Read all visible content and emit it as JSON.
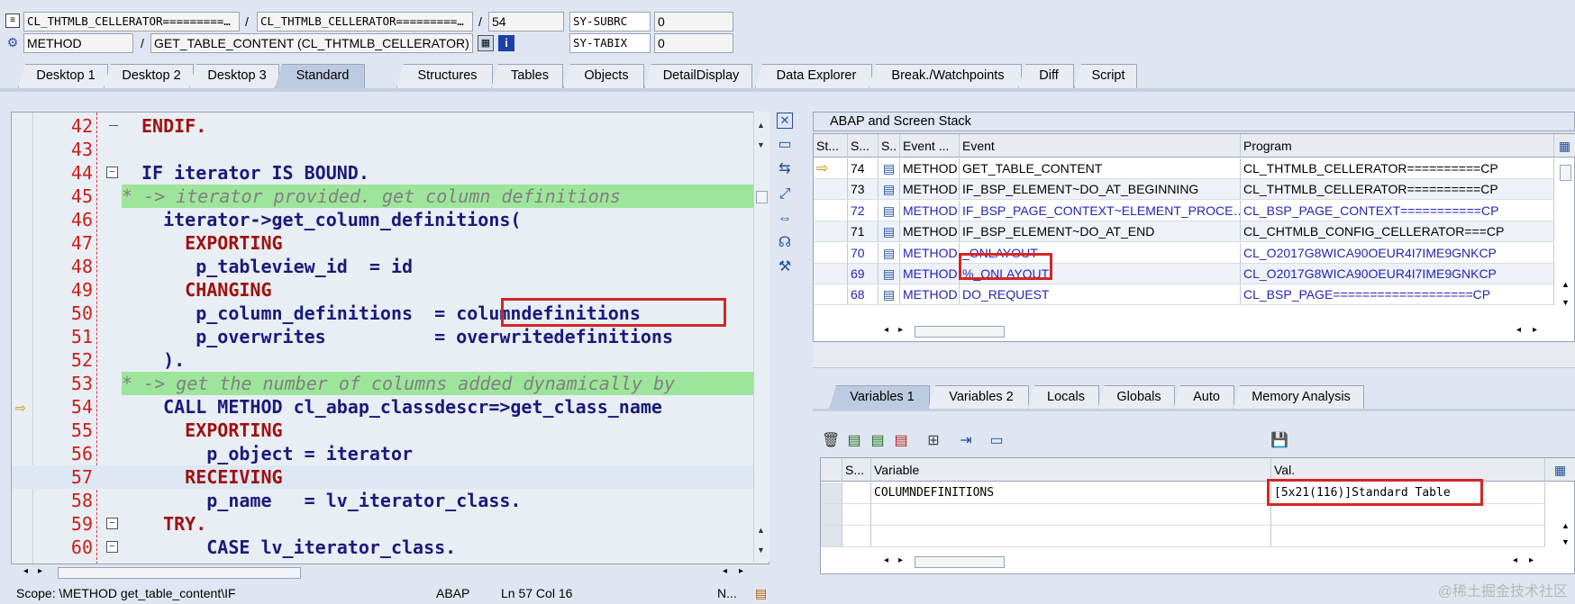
{
  "header": {
    "row1": {
      "class_field": "CL_THTMLB_CELLERATOR=========…",
      "program_field": "CL_THTMLB_CELLERATOR=========…",
      "line_field": "54",
      "sysvar1_name": "SY-SUBRC",
      "sysvar1_value": "0",
      "sep1": "/",
      "sep2": "/"
    },
    "row2": {
      "type_field": "METHOD",
      "method_field": "GET_TABLE_CONTENT (CL_THTMLB_CELLERATOR)",
      "sysvar2_name": "SY-TABIX",
      "sysvar2_value": "0",
      "sep": "/"
    }
  },
  "tabs": [
    "Desktop 1",
    "Desktop 2",
    "Desktop 3",
    "Standard",
    "Structures",
    "Tables",
    "Objects",
    "DetailDisplay",
    "Data Explorer",
    "Break./Watchpoints",
    "Diff",
    "Script"
  ],
  "active_tab": "Standard",
  "editor": {
    "lines": [
      {
        "n": "42",
        "text": "ENDIF.",
        "kind": "kw"
      },
      {
        "n": "43",
        "text": "",
        "kind": "plain"
      },
      {
        "n": "44",
        "text": "IF iterator IS BOUND.",
        "kind": "if"
      },
      {
        "n": "45",
        "text": "* -> iterator provided. get column definitions",
        "kind": "comment"
      },
      {
        "n": "46",
        "text": "  iterator->get_column_definitions(",
        "kind": "call"
      },
      {
        "n": "47",
        "text": "    EXPORTING",
        "kind": "kw"
      },
      {
        "n": "48",
        "text": "     p_tableview_id  = id",
        "kind": "assign"
      },
      {
        "n": "49",
        "text": "    CHANGING",
        "kind": "kw"
      },
      {
        "n": "50",
        "text": "     p_column_definitions  = columndefinitions",
        "kind": "assign"
      },
      {
        "n": "51",
        "text": "     p_overwrites          = overwritedefinitions",
        "kind": "assign"
      },
      {
        "n": "52",
        "text": "  ).",
        "kind": "op"
      },
      {
        "n": "53",
        "text": "* -> get the number of columns added dynamically by",
        "kind": "comment"
      },
      {
        "n": "54",
        "text": "  CALL METHOD cl_abap_classdescr=>get_class_name",
        "kind": "callm"
      },
      {
        "n": "55",
        "text": "    EXPORTING",
        "kind": "kw"
      },
      {
        "n": "56",
        "text": "      p_object = iterator",
        "kind": "assign"
      },
      {
        "n": "57",
        "text": "    RECEIVING",
        "kind": "kw"
      },
      {
        "n": "58",
        "text": "      p_name   = lv_iterator_class.",
        "kind": "assign"
      },
      {
        "n": "59",
        "text": "  TRY.",
        "kind": "kw"
      },
      {
        "n": "60",
        "text": "      CASE lv_iterator_class.",
        "kind": "case"
      }
    ],
    "current_line": "54"
  },
  "status": {
    "scope": "Scope: \\METHOD get_table_content\\IF",
    "lang": "ABAP",
    "pos": "Ln  57 Col  16",
    "mode": "N..."
  },
  "stack": {
    "title": "ABAP and Screen Stack",
    "columns": [
      "St...",
      "S...",
      "S..",
      "Event ...",
      "Event",
      "Program"
    ],
    "rows": [
      {
        "s": "74",
        "etype": "METHOD",
        "event": "GET_TABLE_CONTENT",
        "program": "CL_THTMLB_CELLERATOR==========CP",
        "current": true
      },
      {
        "s": "73",
        "etype": "METHOD",
        "event": "IF_BSP_ELEMENT~DO_AT_BEGINNING",
        "program": "CL_THTMLB_CELLERATOR==========CP",
        "current": false
      },
      {
        "s": "72",
        "etype": "METHOD",
        "event": "IF_BSP_PAGE_CONTEXT~ELEMENT_PROCE…",
        "program": "CL_BSP_PAGE_CONTEXT===========CP",
        "current": false
      },
      {
        "s": "71",
        "etype": "METHOD",
        "event": "IF_BSP_ELEMENT~DO_AT_END",
        "program": "CL_CHTMLB_CONFIG_CELLERATOR===CP",
        "current": false
      },
      {
        "s": "70",
        "etype": "METHOD",
        "event": "_ONLAYOUT",
        "program": "CL_O2017G8WICA90OEUR4I7IME9GNKCP",
        "current": false
      },
      {
        "s": "69",
        "etype": "METHOD",
        "event": "%_ONLAYOUT",
        "program": "CL_O2017G8WICA90OEUR4I7IME9GNKCP",
        "current": false
      },
      {
        "s": "68",
        "etype": "METHOD",
        "event": "DO_REQUEST",
        "program": "CL_BSP_PAGE===================CP",
        "current": false
      }
    ]
  },
  "var_tabs": [
    "Variables 1",
    "Variables 2",
    "Locals",
    "Globals",
    "Auto",
    "Memory Analysis"
  ],
  "active_var_tab": "Variables 1",
  "variables": {
    "columns": [
      "S...",
      "Variable",
      "Val."
    ],
    "rows": [
      {
        "name": "COLUMNDEFINITIONS",
        "value": "[5x21(116)]Standard Table"
      },
      {
        "name": "",
        "value": ""
      },
      {
        "name": "",
        "value": ""
      }
    ]
  },
  "watermark": "@稀土掘金技术社区"
}
